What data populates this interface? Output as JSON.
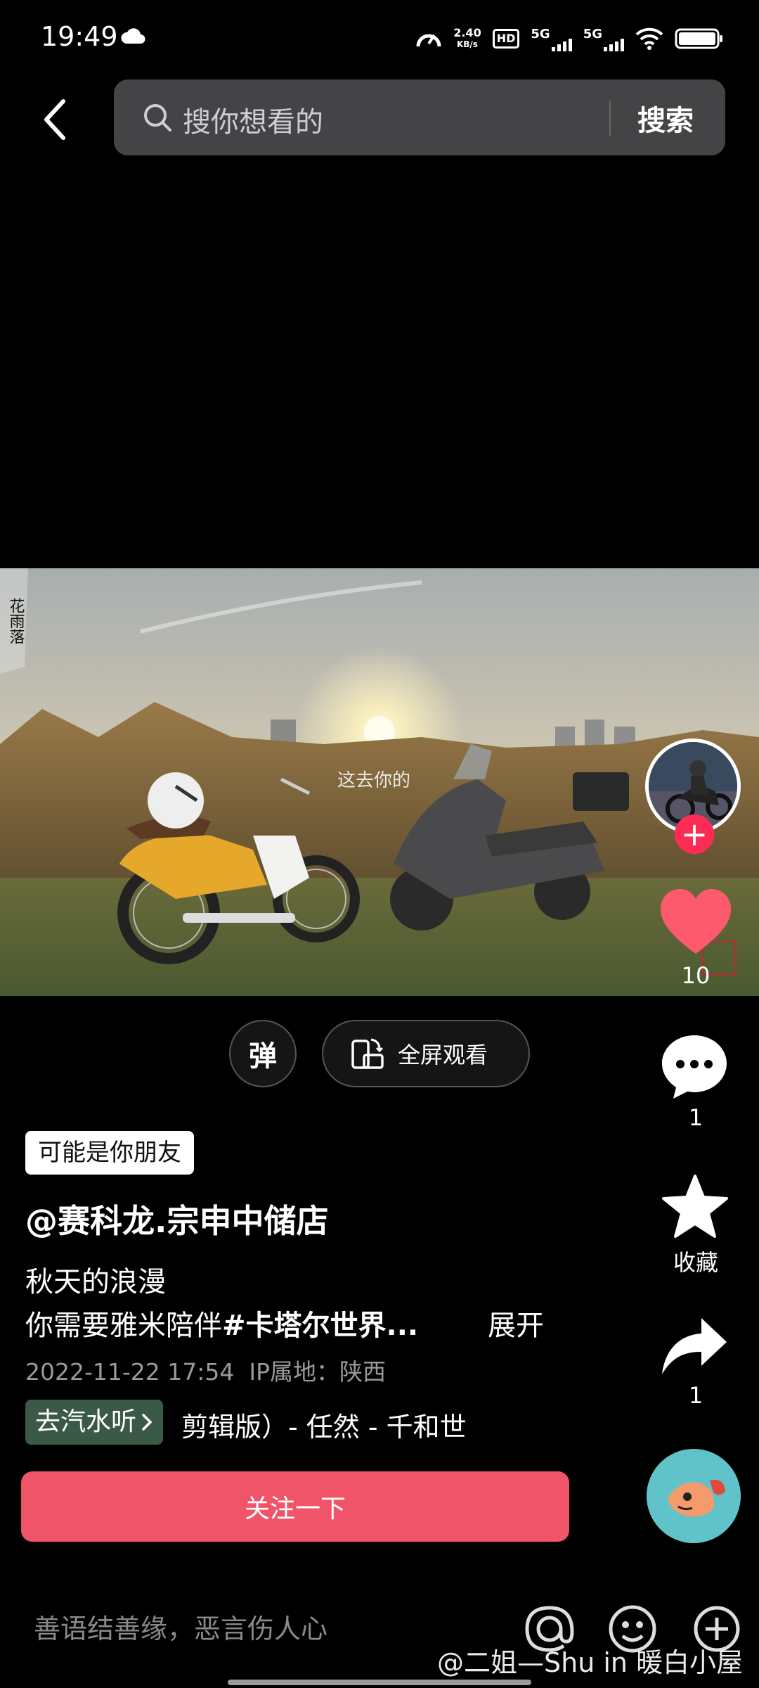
{
  "status_bar": {
    "time": "19:49",
    "net_speed_value": "2.40",
    "net_speed_unit": "KB/s",
    "hd_label": "HD",
    "signal_1": "5G",
    "signal_2": "5G",
    "icons": [
      "cloud-weather-icon",
      "speedometer-icon",
      "hd-voice-icon",
      "signal-5g-icon",
      "wifi-icon",
      "battery-icon"
    ]
  },
  "search": {
    "placeholder": "搜你想看的",
    "button_label": "搜索"
  },
  "video": {
    "overlay_text_corner": "花雨落",
    "overlay_text_center": "这去你的"
  },
  "right_rail": {
    "like_count": "10",
    "comment_count": "1",
    "collect_label": "收藏",
    "share_count": "1",
    "colors": {
      "like": "#fe5a6e",
      "follow_plus": "#fe2c55"
    }
  },
  "controls": {
    "danmaku_label": "弹",
    "fullscreen_label": "全屏观看"
  },
  "post": {
    "friend_tag": "可能是你朋友",
    "author": "@赛科龙.宗申中储店",
    "desc_line1": "秋天的浪漫",
    "desc_line2_prefix": "你需要雅米陪伴",
    "desc_line2_hashtag": "#卡塔尔世界...",
    "expand_label": "展开",
    "date": "2022-11-22 17:54",
    "ip_location": "IP属地：陕西",
    "music_pill": "去汽水听",
    "music_title": "剪辑版）- 任然 - 千和世",
    "follow_button": "关注一下",
    "colors": {
      "follow_button": "#f05468",
      "music_pill": "#3b5a46"
    }
  },
  "bottom_bar": {
    "comment_placeholder": "善语结善缘，恶言伤人心",
    "watermark": "@二姐—Shu in 暖白小屋"
  }
}
